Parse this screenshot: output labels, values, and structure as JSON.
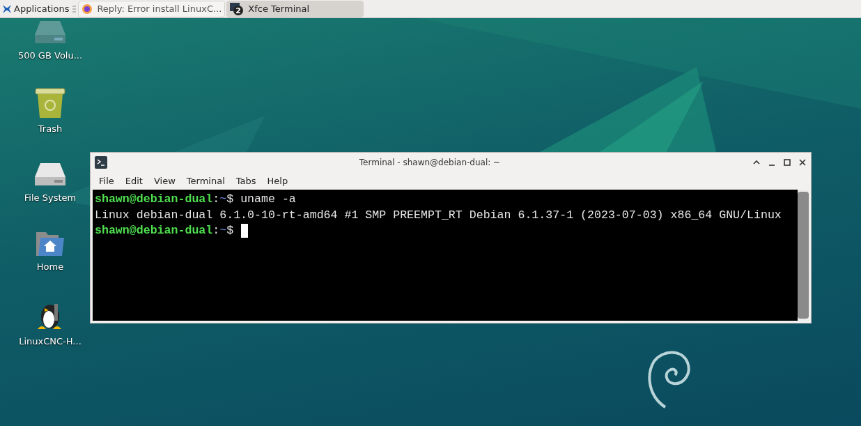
{
  "panel": {
    "applications_label": "Applications",
    "tasks": [
      {
        "label": "Reply: Error install LinuxC...",
        "kind": "browser",
        "selected": false
      },
      {
        "label": "Xfce Terminal",
        "kind": "terminal",
        "badge": "2",
        "selected": true
      }
    ]
  },
  "desktop_icons": [
    {
      "label": "500 GB Volu...",
      "kind": "volume"
    },
    {
      "label": "Trash",
      "kind": "trash"
    },
    {
      "label": "File System",
      "kind": "drive"
    },
    {
      "label": "Home",
      "kind": "home"
    },
    {
      "label": "LinuxCNC-H...",
      "kind": "penguin"
    }
  ],
  "terminal_window": {
    "title": "Terminal - shawn@debian-dual: ~",
    "menu": [
      "File",
      "Edit",
      "View",
      "Terminal",
      "Tabs",
      "Help"
    ],
    "lines": [
      {
        "kind": "prompt",
        "user": "shawn@debian-dual",
        "sep": ":",
        "path": "~",
        "command": "$ uname -a",
        "cursor": false
      },
      {
        "kind": "output",
        "text": "Linux debian-dual 6.1.0-10-rt-amd64 #1 SMP PREEMPT_RT Debian 6.1.37-1 (2023-07-03) x86_64 GNU/Linux"
      },
      {
        "kind": "prompt",
        "user": "shawn@debian-dual",
        "sep": ":",
        "path": "~",
        "command": "$ ",
        "cursor": true
      }
    ]
  }
}
